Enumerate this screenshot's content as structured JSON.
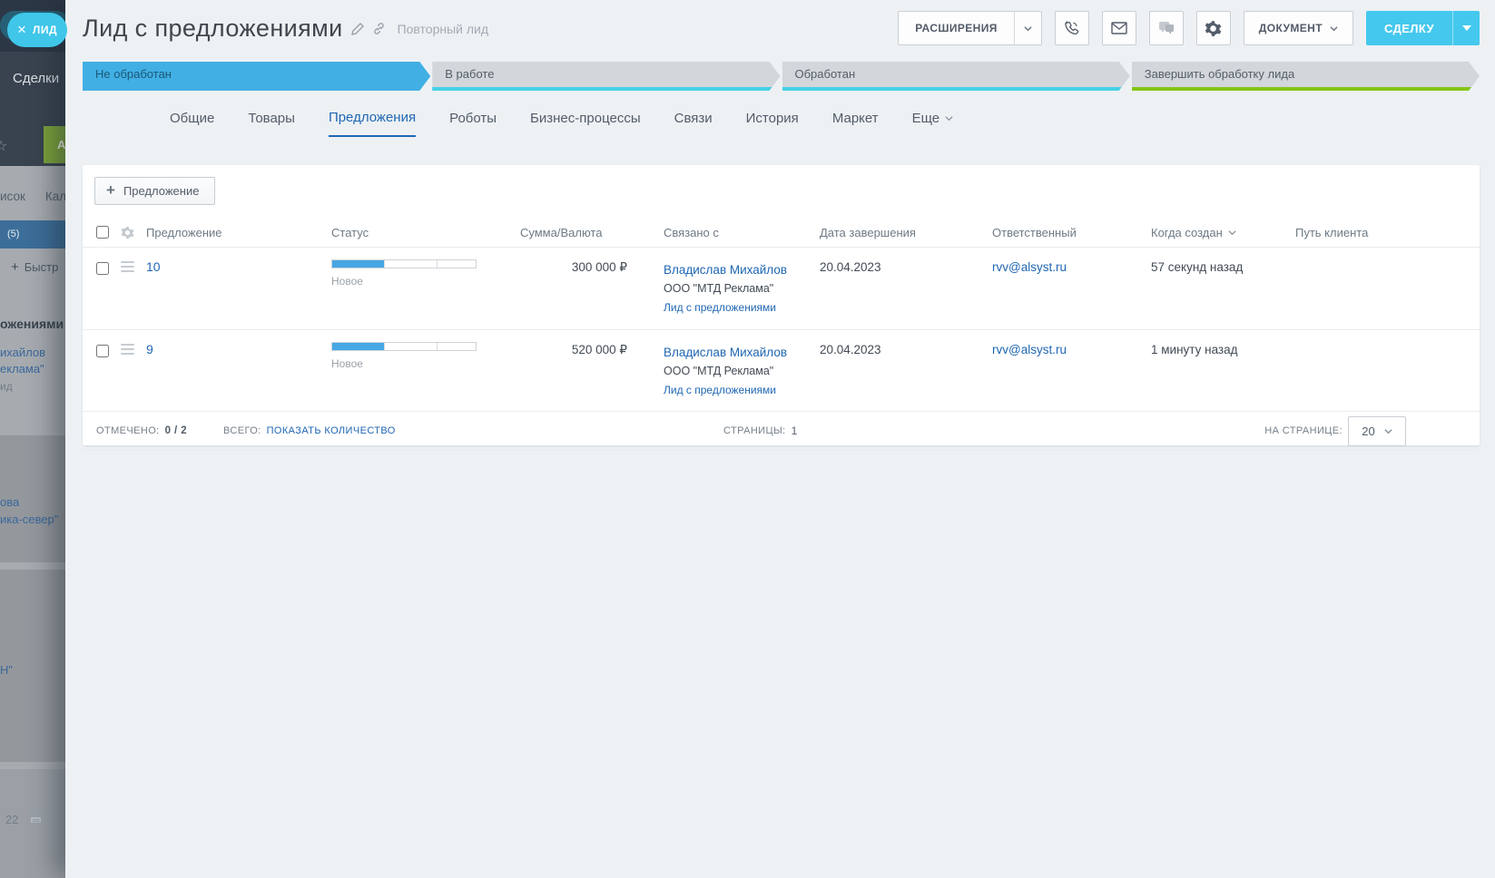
{
  "backdrop": {
    "close_pill": {
      "close_icon": "×",
      "label": "ЛИД"
    },
    "page_title": "Сделки",
    "add_button_fragment": "А",
    "star_fragment": "☆",
    "view_tab_fragment_1": "исок",
    "view_tab_fragment_2": "Кал",
    "counter_fragment": "(5)",
    "quick_plus": "+",
    "quick_add_fragment": "Быстр",
    "deal_name_fragment": "ожениями",
    "contact_link_fragment": "ихайлов",
    "company_link_fragment": "еклама\"",
    "muted_fragment": "ид",
    "link_fragment_ova": "ова",
    "link_fragment_sever": "ика-север\"",
    "link_fragment_n": "Н\"",
    "number_fragment": "22"
  },
  "header": {
    "title": "Лид с предложениями",
    "repeat_lead_label": "Повторный лид",
    "extensions_button": "РАСШИРЕНИЯ",
    "document_button": "ДОКУМЕНТ",
    "deal_button": "СДЕЛКУ"
  },
  "pipeline": {
    "stages": [
      {
        "label": "Не обработан",
        "state": "current"
      },
      {
        "label": "В работе",
        "state": "pending"
      },
      {
        "label": "Обработан",
        "state": "pending"
      },
      {
        "label": "Завершить обработку лида",
        "state": "final"
      }
    ]
  },
  "tabs": [
    {
      "label": "Общие"
    },
    {
      "label": "Товары"
    },
    {
      "label": "Предложения",
      "active": true
    },
    {
      "label": "Роботы"
    },
    {
      "label": "Бизнес-процессы"
    },
    {
      "label": "Связи"
    },
    {
      "label": "История"
    },
    {
      "label": "Маркет"
    },
    {
      "label": "Еще"
    }
  ],
  "grid": {
    "add_button_label": "Предложение",
    "columns": [
      "Предложение",
      "Статус",
      "Сумма/Валюта",
      "Связано с",
      "Дата завершения",
      "Ответственный",
      "Когда создан",
      "Путь клиента"
    ],
    "rows": [
      {
        "id": "10",
        "status_label": "Новое",
        "amount": "300 000 ₽",
        "contact": "Владислав Михайлов",
        "company": "ООО \"МТД Реклама\"",
        "lead_link": "Лид с предложениями",
        "finish_date": "20.04.2023",
        "responsible": "rvv@alsyst.ru",
        "created": "57 секунд назад"
      },
      {
        "id": "9",
        "status_label": "Новое",
        "amount": "520 000 ₽",
        "contact": "Владислав Михайлов",
        "company": "ООО \"МТД Реклама\"",
        "lead_link": "Лид с предложениями",
        "finish_date": "20.04.2023",
        "responsible": "rvv@alsyst.ru",
        "created": "1 минуту назад"
      }
    ],
    "footer": {
      "marked_label": "ОТМЕЧЕНО:",
      "marked_value": "0 / 2",
      "total_label": "ВСЕГО:",
      "total_link": "ПОКАЗАТЬ КОЛИЧЕСТВО",
      "pages_label": "СТРАНИЦЫ:",
      "pages_value": "1",
      "per_page_label": "НА СТРАНИЦЕ:",
      "per_page_value": "20"
    }
  },
  "colors": {
    "stage_current_blue": "#41afe4",
    "stage_underline_cyan": "#45d0e6",
    "stage_underline_green": "#84c515",
    "accent_link_blue": "#2067b3",
    "deal_button_cyan": "#45c8ee",
    "close_pill_teal": "#3fc6e9",
    "progress_fill_blue": "#47a7e4"
  }
}
